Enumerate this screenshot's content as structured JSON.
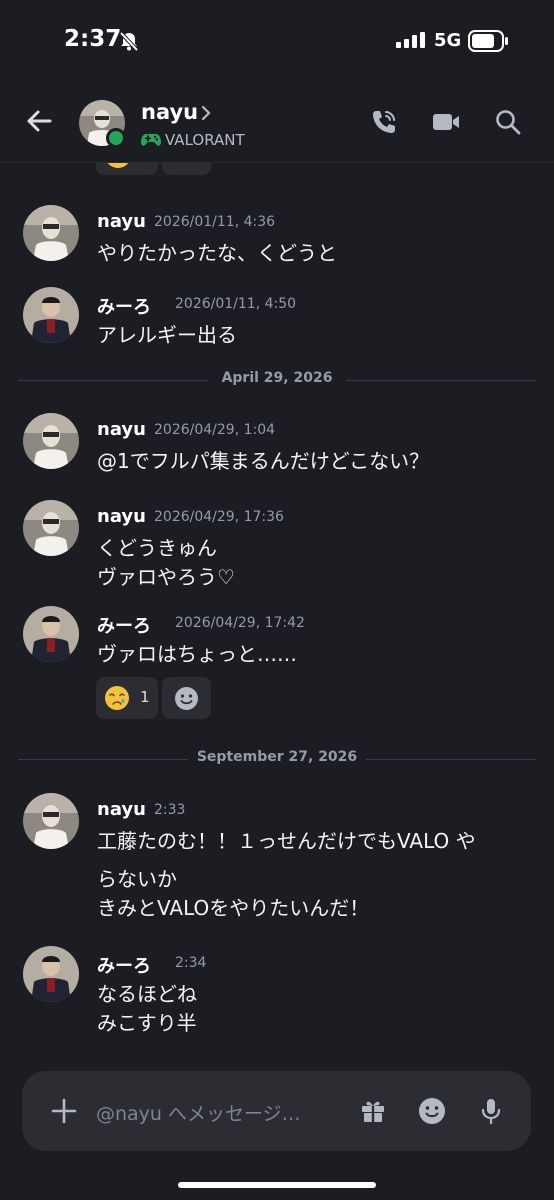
{
  "status_bar": {
    "time": "2:37",
    "network": "5G"
  },
  "header": {
    "name": "nayu",
    "game": "VALORANT"
  },
  "messages": [
    {
      "author": "nayu",
      "timestamp": "2026/01/11, 4:36",
      "lines": [
        "やりたかったな、くどうと"
      ]
    },
    {
      "author": "みーろ",
      "timestamp": "2026/01/11, 4:50",
      "lines": [
        "アレルギー出る"
      ]
    },
    {
      "author": "nayu",
      "timestamp": "2026/04/29, 1:04",
      "lines": [
        "@1でフルパ集まるんだけどこない？"
      ]
    },
    {
      "author": "nayu",
      "timestamp": "2026/04/29, 17:36",
      "lines": [
        "くどうきゅん",
        "ヴァロやろう♡"
      ]
    },
    {
      "author": "みーろ",
      "timestamp": "2026/04/29, 17:42",
      "lines": [
        "ヴァロはちょっと……"
      ]
    },
    {
      "author": "nayu",
      "timestamp": "2:33",
      "lines": [
        "工藤たのむ！！１っせんだけでもVALO や",
        "らないか",
        "きみとVALOをやりたいんだ！"
      ]
    },
    {
      "author": "みーろ",
      "timestamp": "2:34",
      "lines": [
        "なるほどね",
        "みこすり半"
      ]
    }
  ],
  "dividers": [
    "April 29, 2026",
    "September 27, 2026"
  ],
  "reaction": {
    "emoji": "crying-face",
    "count": "1"
  },
  "composer": {
    "placeholder": "@nayu へメッセージ…"
  },
  "colors": {
    "background": "#1c1d22",
    "surface": "#2b2d33",
    "online": "#23a55a",
    "muted": "#949ba4"
  }
}
